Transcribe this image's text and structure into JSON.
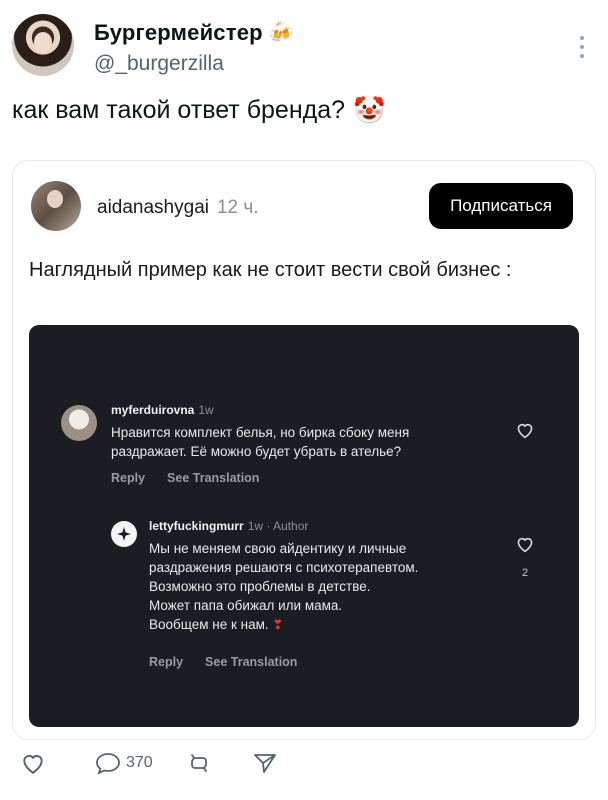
{
  "post": {
    "author_name": "Бургермейстер",
    "author_handle": "@_burgerzilla",
    "text": "как вам такой ответ бренда?",
    "icons": {
      "badge": "beer-mugs-icon",
      "emoji": "clown-face-icon",
      "more": "more-vertical-icon"
    }
  },
  "quote": {
    "username": "aidanashygai",
    "time": "12 ч.",
    "subscribe_label": "Подписаться",
    "text": "Наглядный пример как не стоит вести свой бизнес :"
  },
  "screenshot": {
    "comment1": {
      "username": "myferduirovna",
      "time": "1w",
      "lines": [
        "Нравится комплект белья, но бирка сбоку меня",
        "раздражает. Её можно будет убрать в ателье?"
      ],
      "reply": "Reply",
      "see_translation": "See Translation"
    },
    "comment2": {
      "username": "lettyfuckingmurr",
      "meta": "1w · Author",
      "lines": [
        "Мы не меняем свою айдентику и личные",
        "раздражения решаютя с психотерапевтом.",
        "Возможно это проблемы в детстве.",
        "Может папа обижал или мама.",
        "Вообщем не к нам."
      ],
      "like_count": "2",
      "reply": "Reply",
      "see_translation": "See Translation"
    }
  },
  "actions": {
    "replies_count": "370"
  },
  "colors": {
    "text": "#0f1419",
    "muted": "#536471",
    "dark_bg": "#1c1d22",
    "button_bg": "#000000"
  }
}
